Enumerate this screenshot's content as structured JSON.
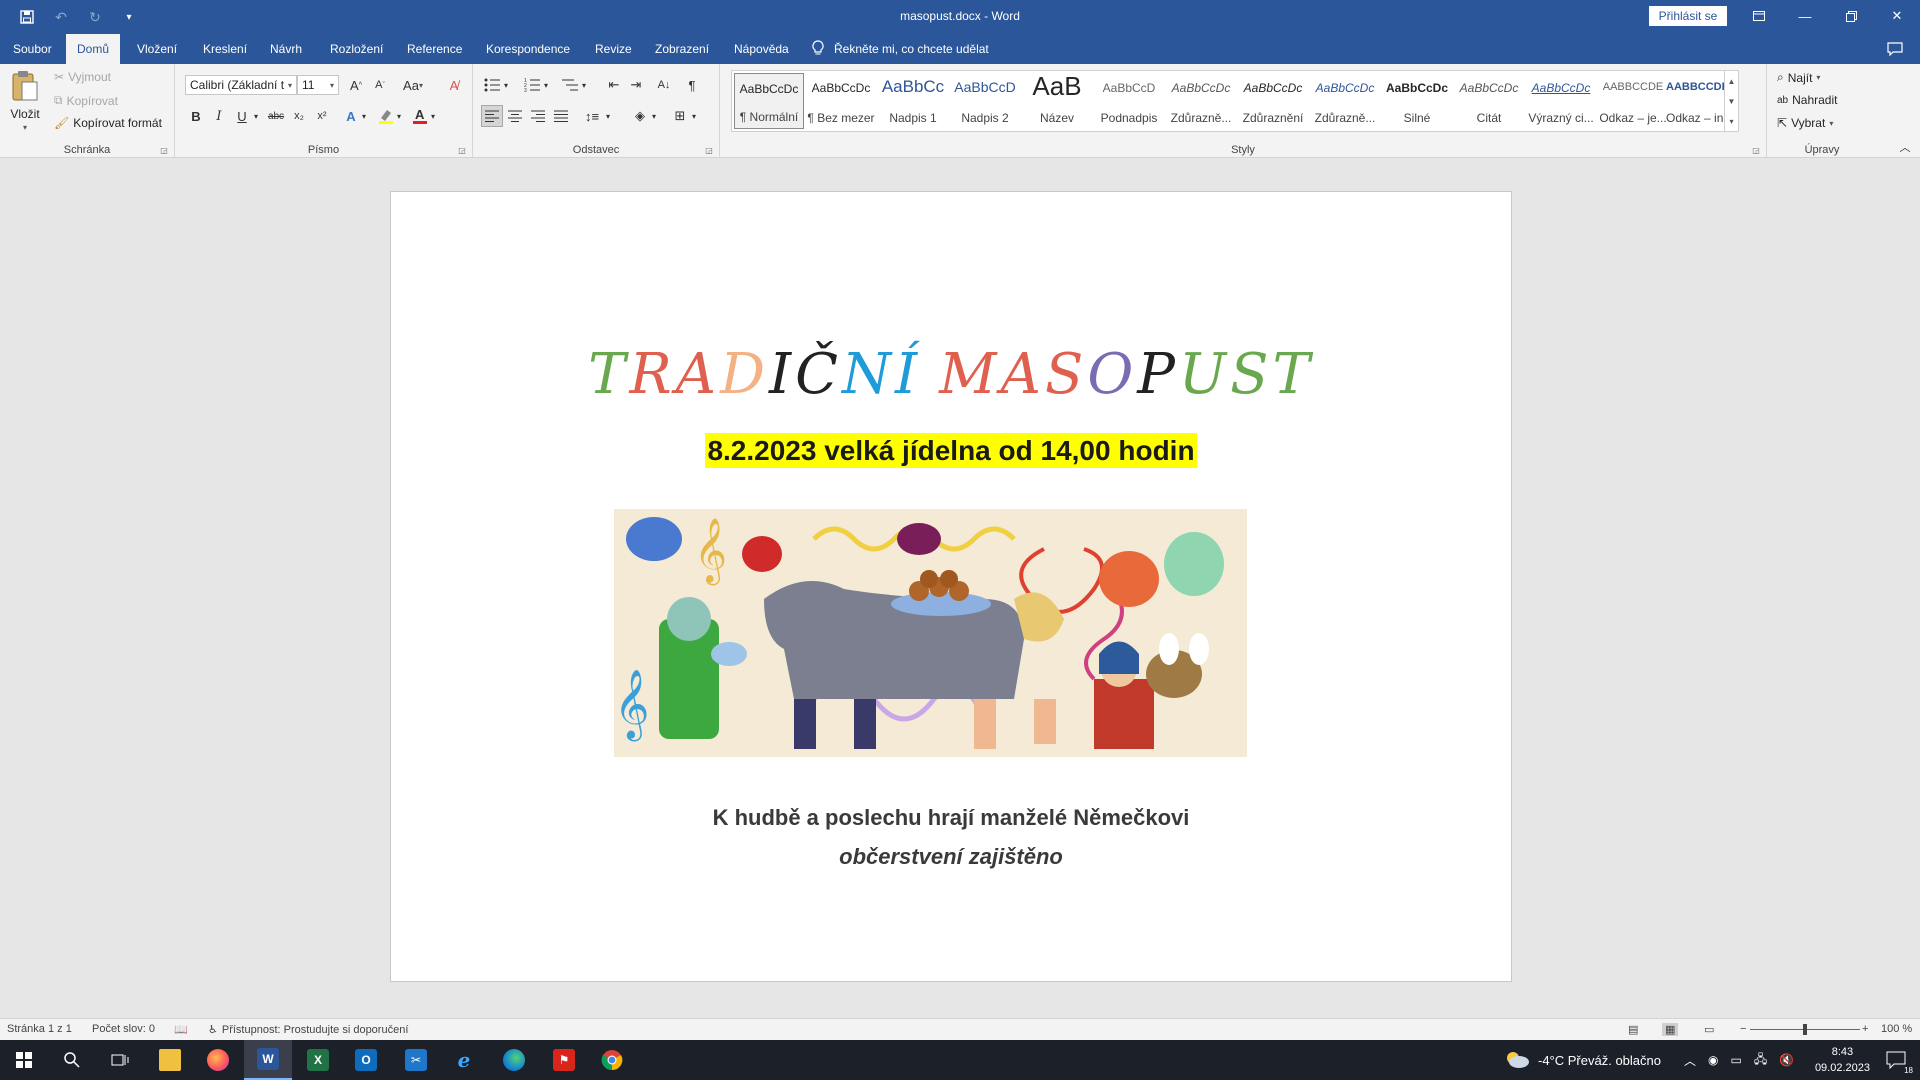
{
  "window": {
    "title": "masopust.docx  -  Word",
    "signin_label": "Přihlásit se",
    "controls": [
      "ribbon-display-icon",
      "minimize-icon",
      "restore-icon",
      "close-icon"
    ]
  },
  "tabs": [
    {
      "label": "Soubor",
      "active": false
    },
    {
      "label": "Domů",
      "active": true
    },
    {
      "label": "Vložení",
      "active": false
    },
    {
      "label": "Kreslení",
      "active": false
    },
    {
      "label": "Návrh",
      "active": false
    },
    {
      "label": "Rozložení",
      "active": false
    },
    {
      "label": "Reference",
      "active": false
    },
    {
      "label": "Korespondence",
      "active": false
    },
    {
      "label": "Revize",
      "active": false
    },
    {
      "label": "Zobrazení",
      "active": false
    },
    {
      "label": "Nápověda",
      "active": false
    }
  ],
  "tellme": "Řekněte mi, co chcete udělat",
  "ribbon": {
    "clipboard": {
      "label": "Schránka",
      "paste": "Vložit",
      "cut": "Vyjmout",
      "copy": "Kopírovat",
      "format_painter": "Kopírovat formát"
    },
    "font": {
      "label": "Písmo",
      "font_name": "Calibri (Základní t",
      "font_size": "11",
      "case_label": "Aa",
      "bold": "B",
      "italic": "I",
      "underline": "U",
      "strike": "abc",
      "subscript": "x₂",
      "superscript": "x²"
    },
    "paragraph": {
      "label": "Odstavec"
    },
    "styles": {
      "label": "Styly",
      "items": [
        {
          "sample": "AaBbCcDc",
          "name": "¶ Normální"
        },
        {
          "sample": "AaBbCcDc",
          "name": "¶ Bez mezer"
        },
        {
          "sample": "AaBbCc",
          "name": "Nadpis 1"
        },
        {
          "sample": "AaBbCcD",
          "name": "Nadpis 2"
        },
        {
          "sample": "AaB",
          "name": "Název"
        },
        {
          "sample": "AaBbCcD",
          "name": "Podnadpis"
        },
        {
          "sample": "AaBbCcDc",
          "name": "Zdůrazně..."
        },
        {
          "sample": "AaBbCcDc",
          "name": "Zdůraznění"
        },
        {
          "sample": "AaBbCcDc",
          "name": "Zdůrazně..."
        },
        {
          "sample": "AaBbCcDc",
          "name": "Silné"
        },
        {
          "sample": "AaBbCcDc",
          "name": "Citát"
        },
        {
          "sample": "AaBbCcDc",
          "name": "Výrazný ci..."
        },
        {
          "sample": "AABBCCDE",
          "name": "Odkaz – je..."
        },
        {
          "sample": "AABBCCDE",
          "name": "Odkaz – in..."
        }
      ]
    },
    "editing": {
      "label": "Úpravy",
      "find": "Najít",
      "replace": "Nahradit",
      "select": "Vybrat"
    }
  },
  "document": {
    "title_letters": [
      {
        "ch": "T",
        "color": "#6aa84f"
      },
      {
        "ch": "R",
        "color": "#e06050"
      },
      {
        "ch": "A",
        "color": "#e06050"
      },
      {
        "ch": "D",
        "color": "#f4b183"
      },
      {
        "ch": "I",
        "color": "#222222"
      },
      {
        "ch": "Č",
        "color": "#222222"
      },
      {
        "ch": "N",
        "color": "#1f9bd7"
      },
      {
        "ch": "Í",
        "color": "#1f9bd7"
      },
      {
        "ch": " ",
        "color": "#222222"
      },
      {
        "ch": "M",
        "color": "#e06050"
      },
      {
        "ch": "A",
        "color": "#e06050"
      },
      {
        "ch": "S",
        "color": "#e06050"
      },
      {
        "ch": "O",
        "color": "#7b6bb3"
      },
      {
        "ch": "P",
        "color": "#222222"
      },
      {
        "ch": "U",
        "color": "#6aa84f"
      },
      {
        "ch": "S",
        "color": "#6aa84f"
      },
      {
        "ch": "T",
        "color": "#6aa84f"
      }
    ],
    "date_line": "8.2.2023 velká jídelna od 14,00 hodin",
    "music_line": "K hudbě a poslechu hrají manželé Němečkovi",
    "refreshments_line": "občerstvení zajištěno",
    "highlight_color": "#ffff00"
  },
  "statusbar": {
    "page": "Stránka 1 z 1",
    "words": "Počet slov: 0",
    "accessibility": "Přístupnost: Prostudujte si doporučení",
    "zoom": "100 %"
  },
  "taskbar": {
    "apps": [
      "start-icon",
      "search-icon",
      "task-view-icon",
      "file-explorer-icon",
      "firefox-icon",
      "word-icon",
      "excel-icon",
      "outlook-icon",
      "snipping-tool-icon",
      "internet-explorer-icon",
      "edge-icon",
      "acrobat-icon",
      "chrome-icon"
    ],
    "weather": "-4°C  Převáž. oblačno",
    "time": "8:43",
    "date": "09.02.2023",
    "notifications": "18"
  }
}
